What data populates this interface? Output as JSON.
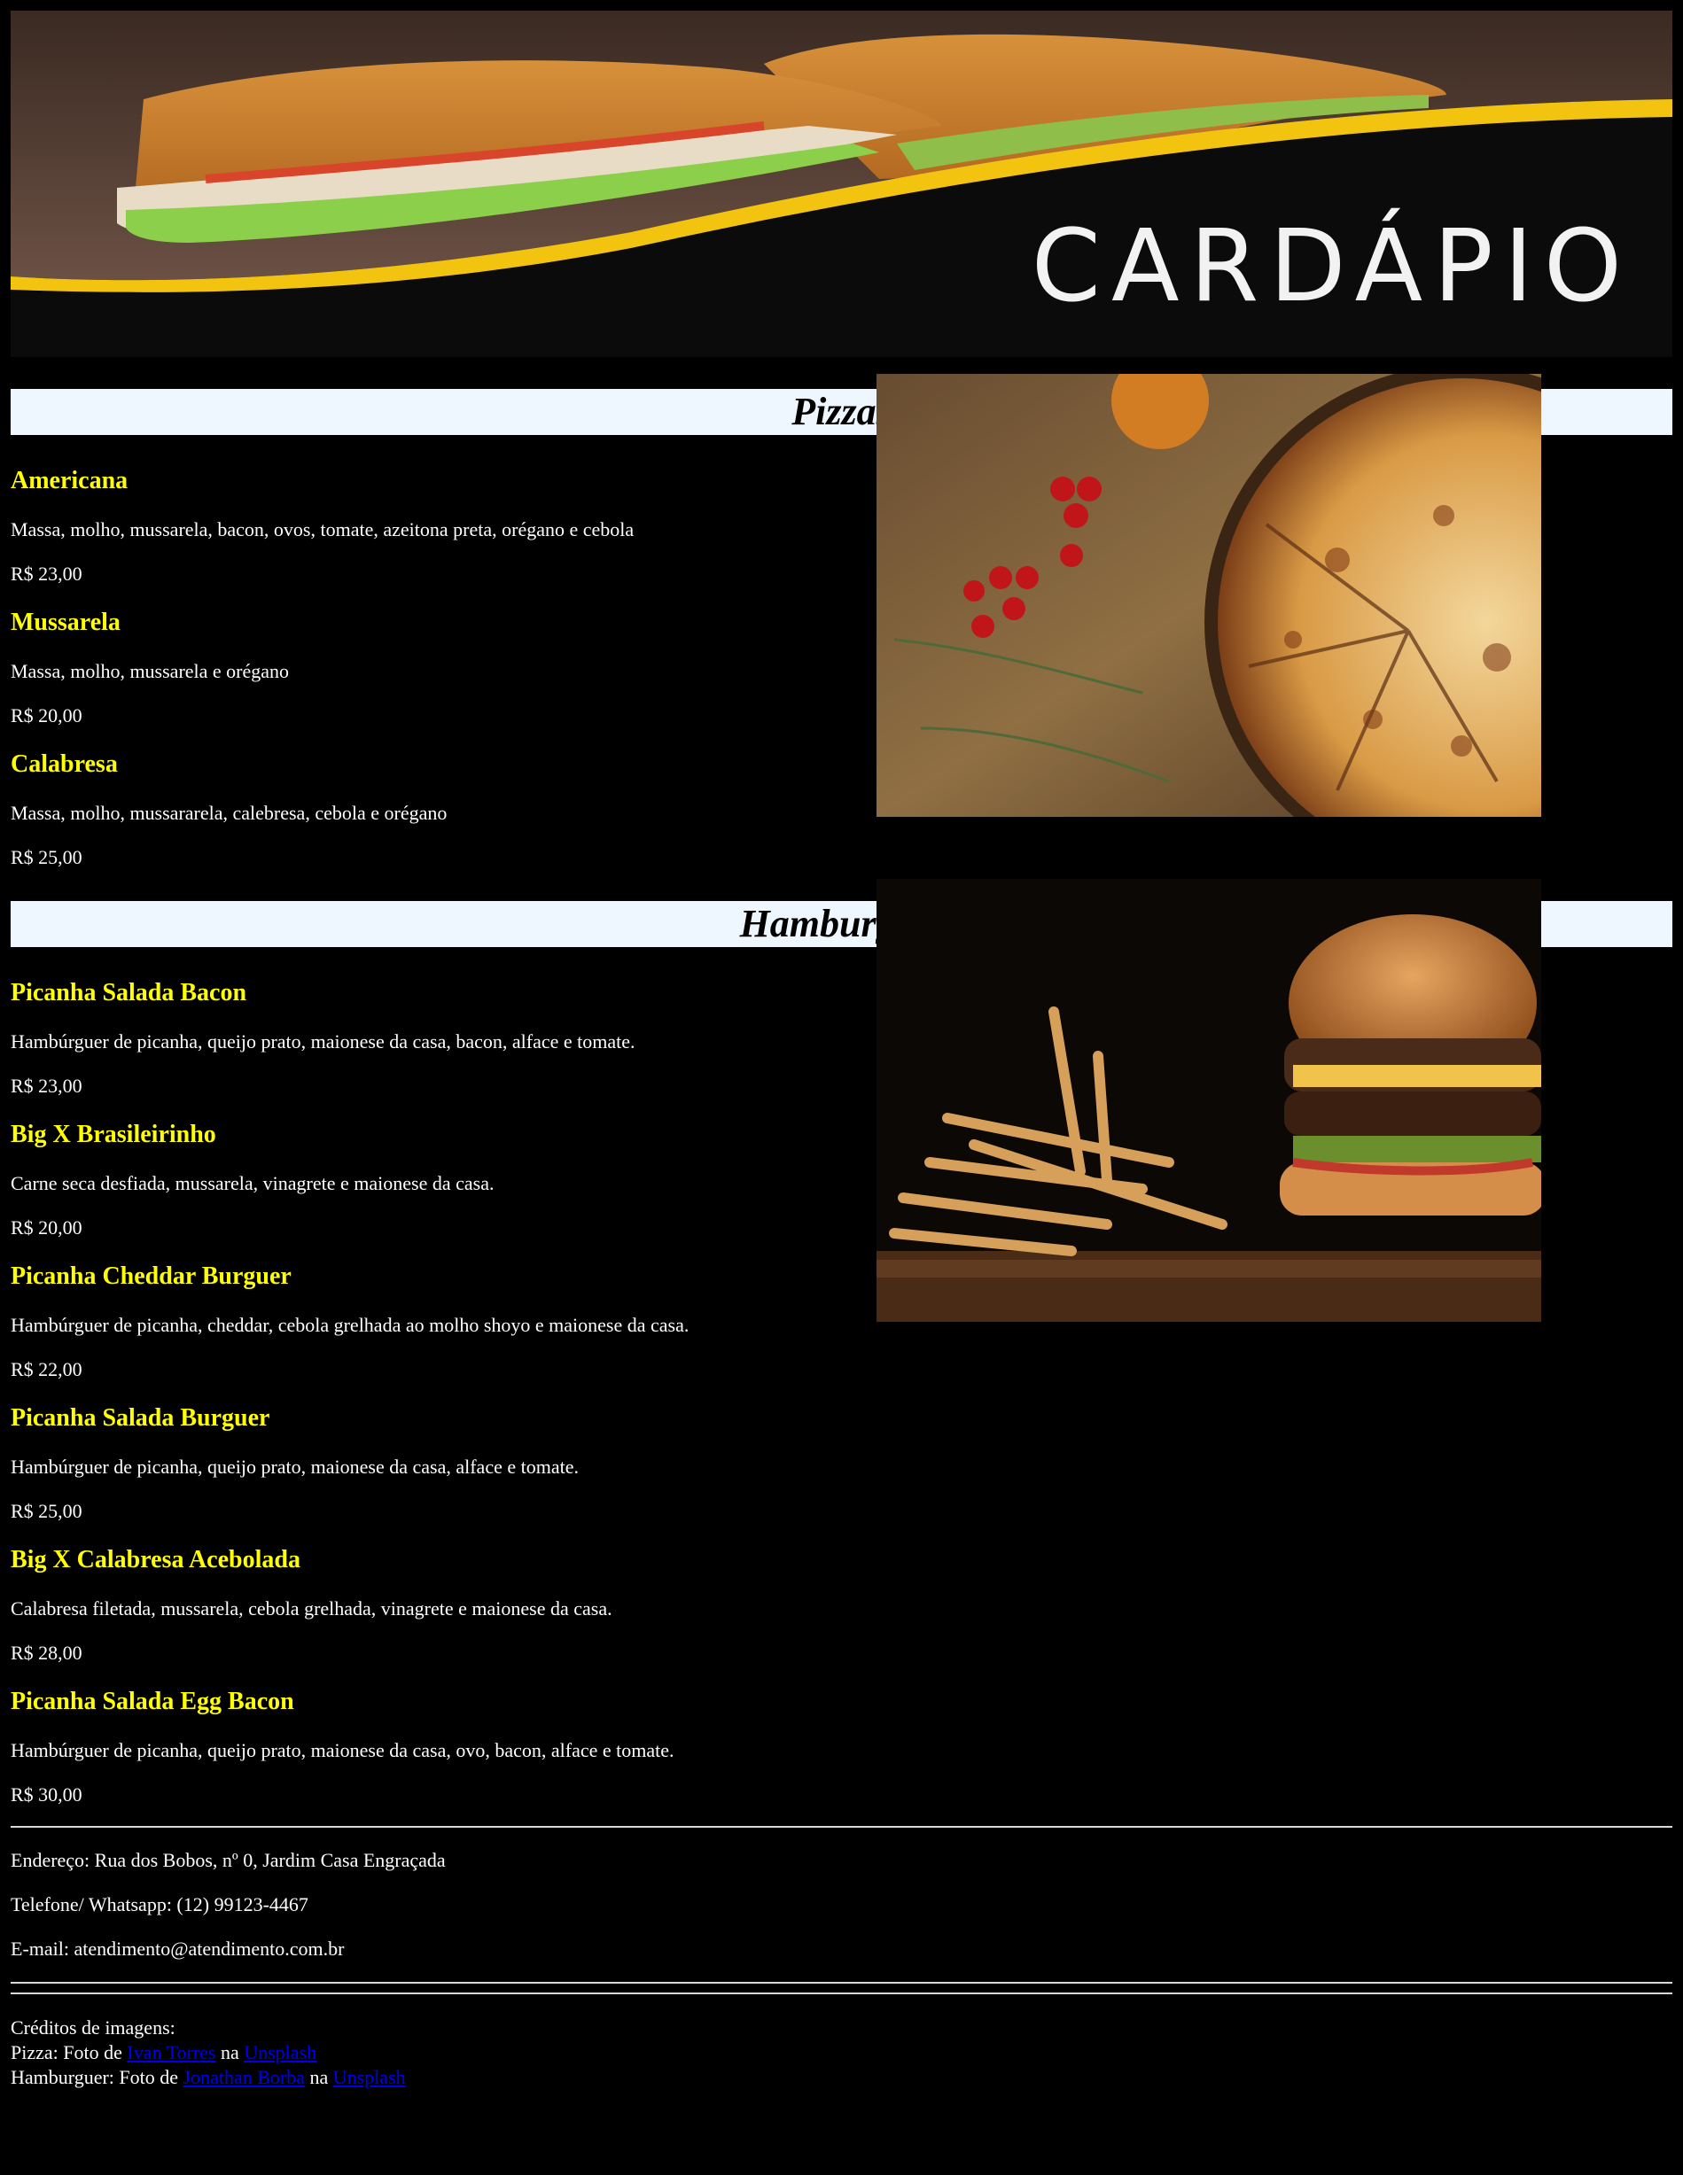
{
  "banner": {
    "title": "CARDÁPIO"
  },
  "pizzas": {
    "title": "Pizzas",
    "items": [
      {
        "name": "Americana",
        "desc": "Massa, molho, mussarela, bacon, ovos, tomate, azeitona preta, orégano e cebola",
        "price": "R$ 23,00"
      },
      {
        "name": "Mussarela",
        "desc": "Massa, molho, mussarela e orégano",
        "price": "R$ 20,00"
      },
      {
        "name": "Calabresa",
        "desc": "Massa, molho, mussararela, calebresa, cebola e orégano",
        "price": "R$ 25,00"
      }
    ]
  },
  "burgers": {
    "title": "Hamburgers",
    "items": [
      {
        "name": "Picanha Salada Bacon",
        "desc": "Hambúrguer de picanha, queijo prato, maionese da casa, bacon, alface e tomate.",
        "price": "R$ 23,00"
      },
      {
        "name": "Big X Brasileirinho",
        "desc": "Carne seca desfiada, mussarela, vinagrete e maionese da casa.",
        "price": "R$ 20,00"
      },
      {
        "name": "Picanha Cheddar Burguer",
        "desc": "Hambúrguer de picanha, cheddar, cebola grelhada ao molho shoyo e maionese da casa.",
        "price": "R$ 22,00"
      },
      {
        "name": "Picanha Salada Burguer",
        "desc": "Hambúrguer de picanha, queijo prato, maionese da casa, alface e tomate.",
        "price": "R$ 25,00"
      },
      {
        "name": "Big X Calabresa Acebolada",
        "desc": "Calabresa filetada, mussarela, cebola grelhada, vinagrete e maionese da casa.",
        "price": "R$ 28,00"
      },
      {
        "name": "Picanha Salada Egg Bacon",
        "desc": "Hambúrguer de picanha, queijo prato, maionese da casa, ovo, bacon, alface e tomate.",
        "price": "R$ 30,00"
      }
    ]
  },
  "contact": {
    "address": "Endereço: Rua dos Bobos, nº 0, Jardim Casa Engraçada",
    "phone": "Telefone/ Whatsapp: (12) 99123-4467",
    "email": "E-mail: atendimento@atendimento.com.br"
  },
  "credits": {
    "heading": "Créditos de imagens:",
    "pizza_prefix": "Pizza: Foto de",
    "pizza_author": "Ivan Torres",
    "pizza_mid": "na",
    "pizza_site": "Unsplash",
    "burger_prefix": "Hamburguer: Foto de",
    "burger_author": "Jonathan Borba",
    "burger_mid": "na",
    "burger_site": "Unsplash"
  },
  "colors": {
    "item_name": "#ffff00",
    "section_bg": "#eef6ff",
    "page_bg": "#000000",
    "link": "#0000ee"
  }
}
